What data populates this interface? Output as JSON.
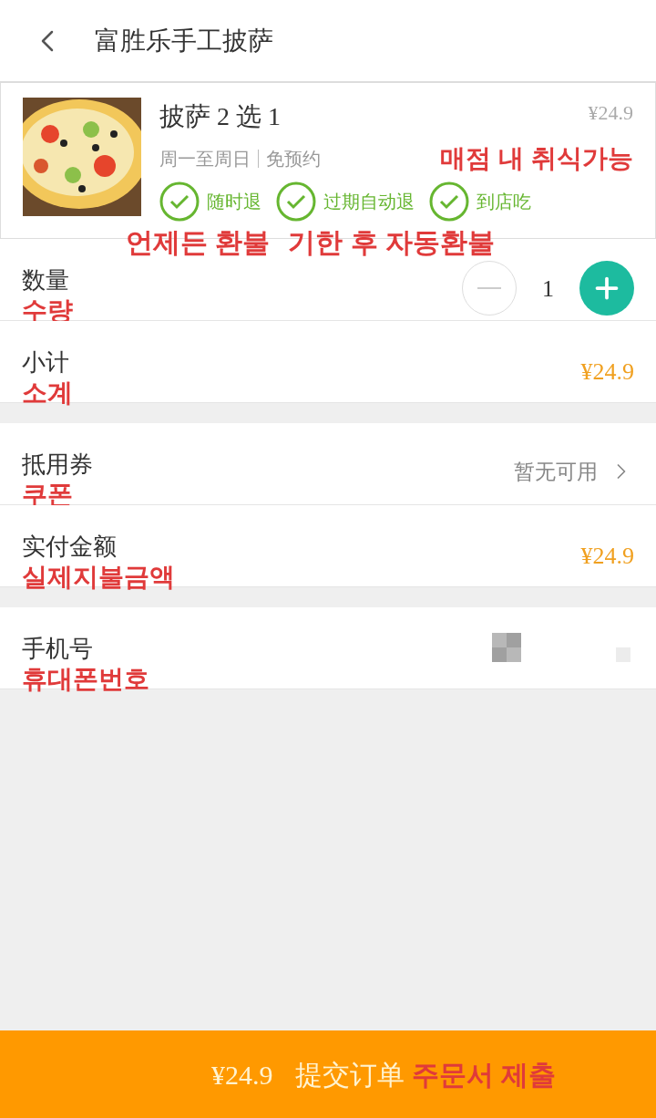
{
  "header": {
    "title": "富胜乐手工披萨"
  },
  "product": {
    "name": "披萨 2 选 1",
    "price": "¥24.9",
    "days": "周一至周日",
    "booking": "免预约",
    "note": "매점 내 취식가능",
    "badges": [
      {
        "label": "随时退"
      },
      {
        "label": "过期自动退"
      },
      {
        "label": "到店吃"
      }
    ],
    "badge_notes": [
      "언제든 환불",
      "기한 후 자동환불"
    ]
  },
  "quantity": {
    "label": "数量",
    "annotation": "수량",
    "value": "1",
    "minus_disabled": true
  },
  "subtotal": {
    "label": "小计",
    "annotation": "소계",
    "value": "¥24.9"
  },
  "coupon": {
    "label": "抵用券",
    "annotation": "쿠폰",
    "value": "暂无可用"
  },
  "total": {
    "label": "实付金额",
    "annotation": "실제지불금액",
    "value": "¥24.9"
  },
  "phone": {
    "label": "手机号",
    "annotation": "휴대폰번호"
  },
  "footer": {
    "price": "¥24.9",
    "button": "提交订单",
    "annotation": "주문서 제출"
  }
}
